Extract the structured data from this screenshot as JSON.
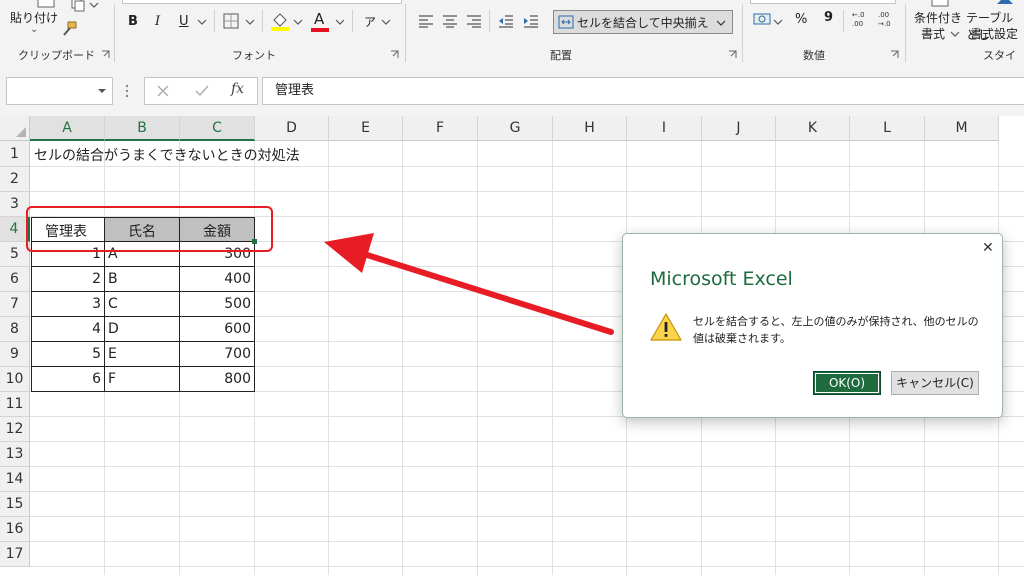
{
  "ribbon": {
    "clipboard": {
      "paste_label": "貼り付け",
      "paste_arrow": "⌄",
      "group_label": "クリップボード"
    },
    "font": {
      "bold": "B",
      "italic": "I",
      "underline": "U",
      "font_color_letter": "A",
      "phonetic_letter": "ア",
      "group_label": "フォント"
    },
    "alignment": {
      "merge_button_label": "セルを結合して中央揃え",
      "group_label": "配置"
    },
    "number": {
      "percent": "%",
      "comma": "9",
      "inc_decimal": "←.0 .00",
      "dec_decimal": ".00 →.0",
      "group_label": "数値"
    },
    "styles": {
      "conditional_label_1": "条件付き",
      "conditional_label_2": "書式",
      "table_label_1": "テーブルとし",
      "table_label_2": "書式設定",
      "group_label": "スタイル"
    },
    "colors": {
      "font_color_bar": "#e81123",
      "fill_color_bar": "#ffff00"
    }
  },
  "formula_bar": {
    "name_box_value": "",
    "fx_label": "fx",
    "content": "管理表"
  },
  "columns": [
    "A",
    "B",
    "C",
    "D",
    "E",
    "F",
    "G",
    "H",
    "I",
    "J",
    "K",
    "L",
    "M"
  ],
  "rows": [
    "1",
    "2",
    "3",
    "4",
    "5",
    "6",
    "7",
    "8",
    "9",
    "10",
    "11",
    "12",
    "13",
    "14",
    "15",
    "16",
    "17"
  ],
  "sheet": {
    "title": "セルの結合がうまくできないときの対処法",
    "headers": [
      "管理表",
      "氏名",
      "金額"
    ],
    "records": [
      [
        "1",
        "A",
        "300"
      ],
      [
        "2",
        "B",
        "400"
      ],
      [
        "3",
        "C",
        "500"
      ],
      [
        "4",
        "D",
        "600"
      ],
      [
        "5",
        "E",
        "700"
      ],
      [
        "6",
        "F",
        "800"
      ]
    ]
  },
  "dialog": {
    "title": "Microsoft Excel",
    "message_line_1": "セルを結合すると、左上の値のみが保持され、他のセルの",
    "message_line_2": "値は破棄されます。",
    "ok_label": "OK(O)",
    "cancel_label": "キャンセル(C)",
    "close_glyph": "✕"
  },
  "annotation": {
    "highlight_color": "#e81c24"
  },
  "theme": {
    "accent": "#217346",
    "ok_button_bg": "#1e6b3e"
  }
}
